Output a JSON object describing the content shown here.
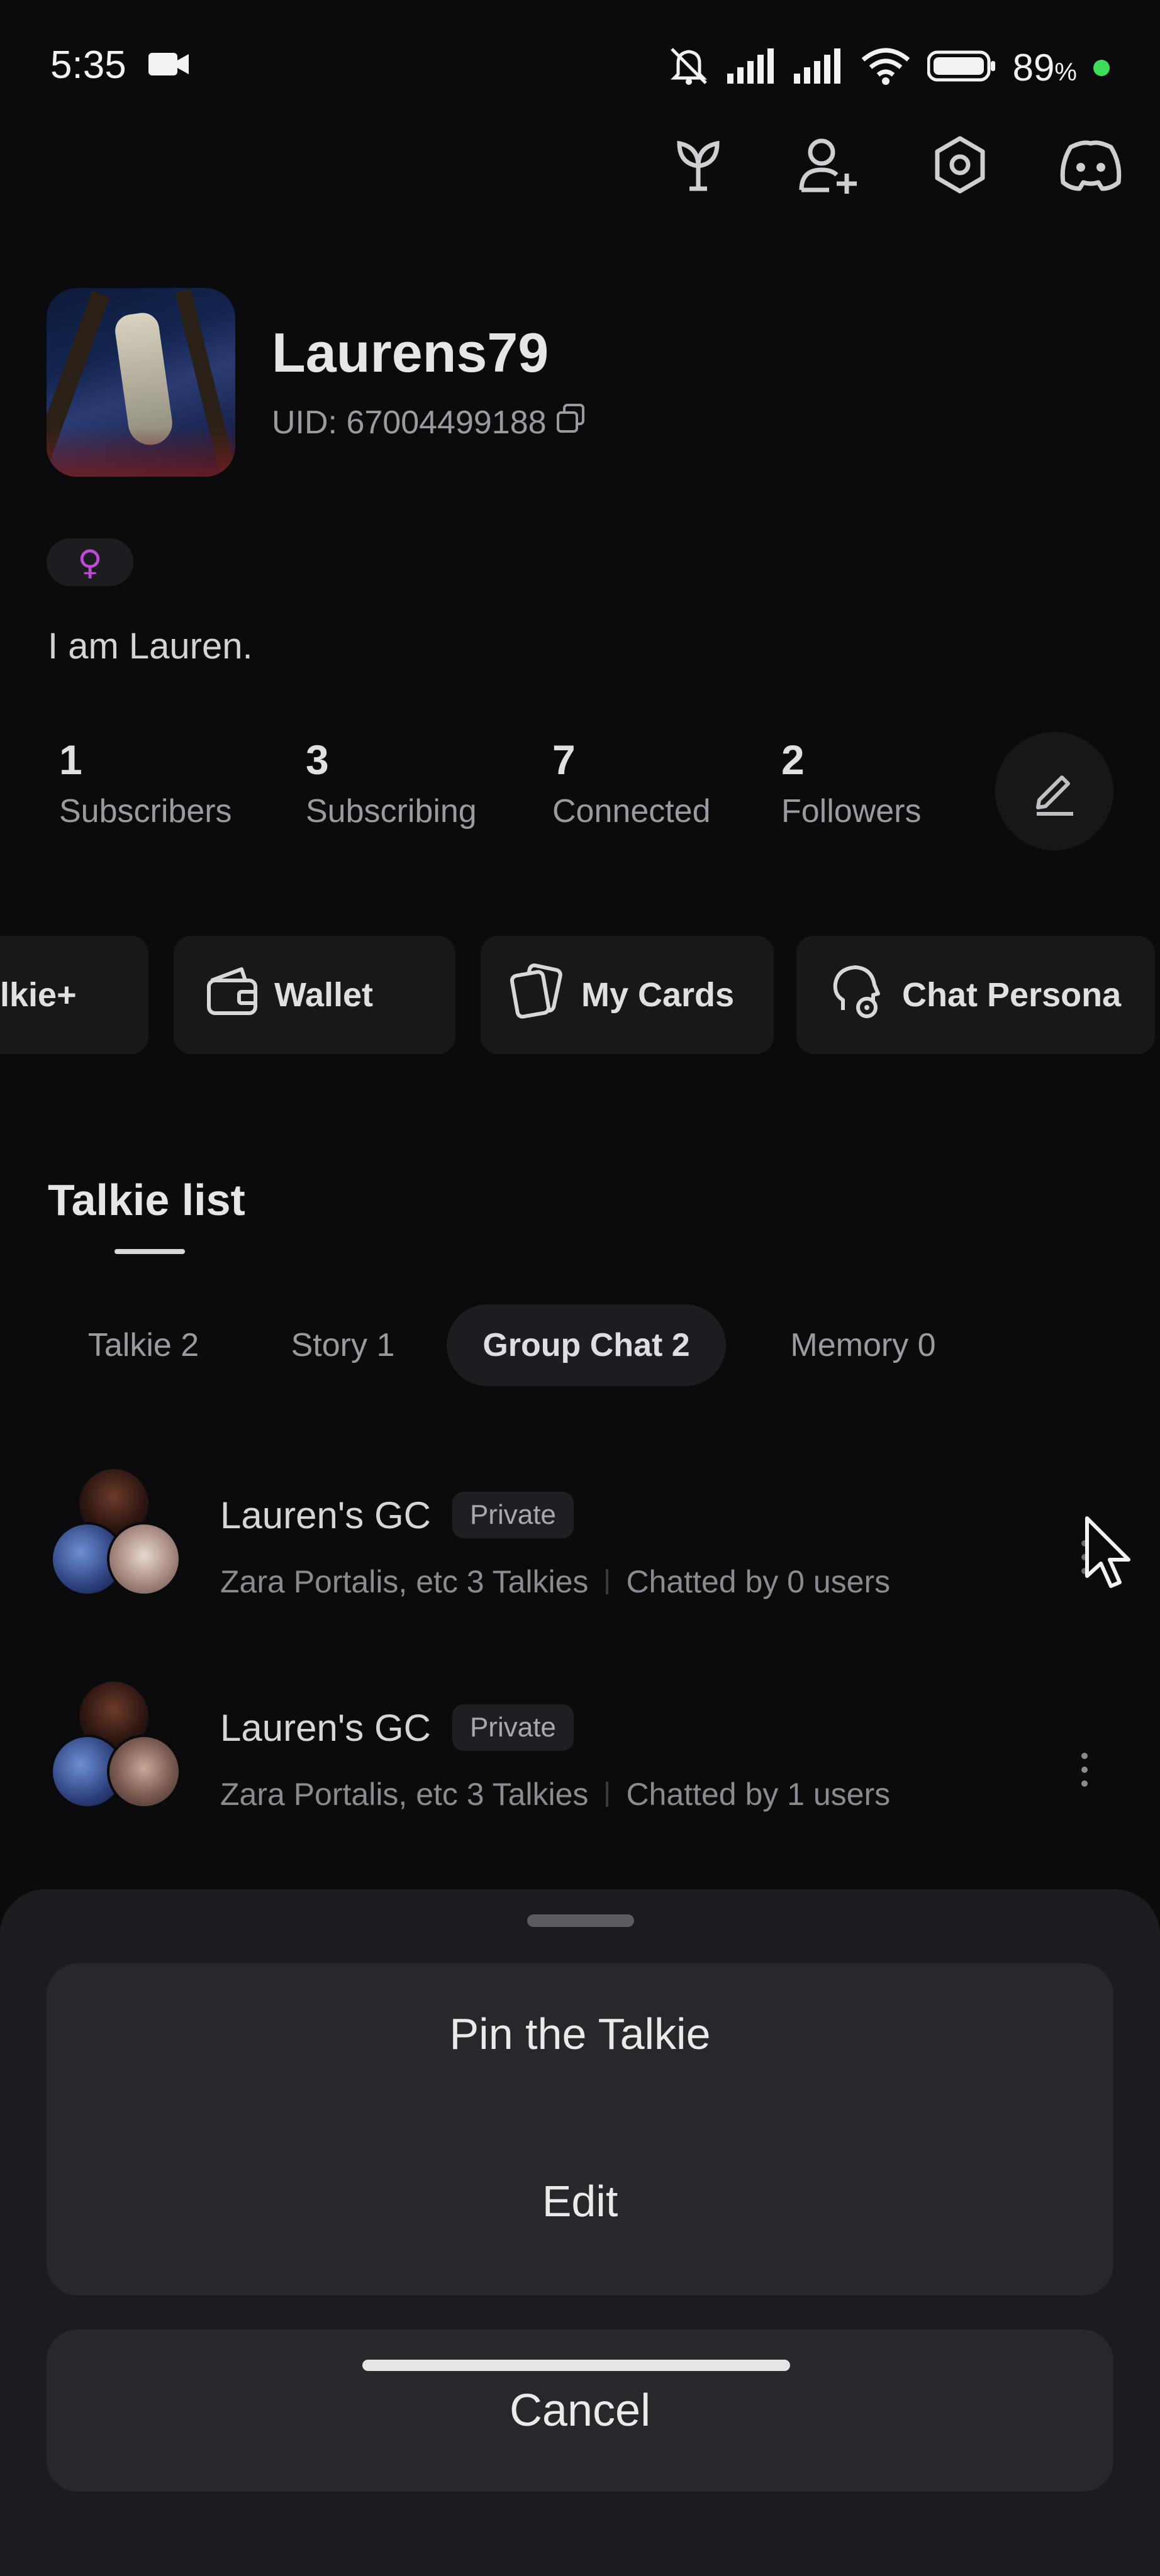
{
  "status_bar": {
    "time": "5:35",
    "battery_percent": "89",
    "battery_suffix": "%"
  },
  "top_icons": [
    "sprout-icon",
    "add-friend-icon",
    "settings-hex-icon",
    "discord-icon"
  ],
  "profile": {
    "username": "Laurens79",
    "uid": "UID: 67004499188",
    "gender_symbol": "♀",
    "bio": "I am Lauren."
  },
  "stats": [
    {
      "value": "1",
      "label": "Subscribers"
    },
    {
      "value": "3",
      "label": "Subscribing"
    },
    {
      "value": "7",
      "label": "Connected"
    },
    {
      "value": "2",
      "label": "Followers"
    }
  ],
  "chips": [
    {
      "label": "lkie+"
    },
    {
      "label": "Wallet"
    },
    {
      "label": "My Cards"
    },
    {
      "label": "Chat Persona"
    }
  ],
  "talkie_list": {
    "title": "Talkie list",
    "tabs": [
      {
        "label": "Talkie 2",
        "active": false
      },
      {
        "label": "Story 1",
        "active": false
      },
      {
        "label": "Group Chat 2",
        "active": true
      },
      {
        "label": "Memory 0",
        "active": false
      }
    ],
    "items": [
      {
        "name": "Lauren's GC",
        "badge": "Private",
        "members": "Zara Portalis, etc 3 Talkies",
        "chatted": "Chatted by 0 users"
      },
      {
        "name": "Lauren's GC",
        "badge": "Private",
        "members": "Zara Portalis, etc 3 Talkies",
        "chatted": "Chatted by 1 users"
      }
    ]
  },
  "sheet": {
    "options": [
      "Pin the Talkie",
      "Edit"
    ],
    "cancel": "Cancel"
  },
  "colors": {
    "background": "#0b0b0d",
    "sheet": "#1b1c1f",
    "card": "#27282c",
    "gender_accent": "#c04ad8",
    "status_dot": "#3ddc5a"
  }
}
